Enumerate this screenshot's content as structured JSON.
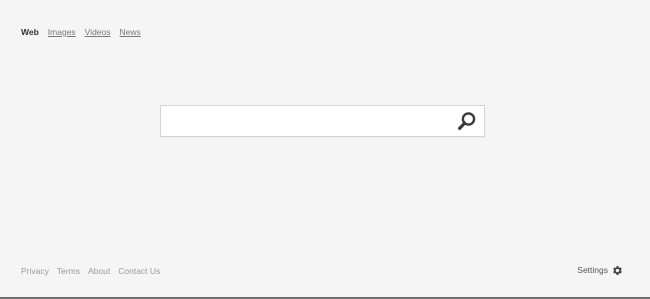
{
  "nav": {
    "items": [
      {
        "label": "Web",
        "active": true
      },
      {
        "label": "Images",
        "active": false
      },
      {
        "label": "Videos",
        "active": false
      },
      {
        "label": "News",
        "active": false
      }
    ]
  },
  "search": {
    "value": "",
    "placeholder": "",
    "button_icon": "search-icon"
  },
  "footer": {
    "links": [
      "Privacy",
      "Terms",
      "About",
      "Contact Us"
    ],
    "settings_label": "Settings",
    "settings_icon": "gear-icon"
  },
  "colors": {
    "background": "#f5f5f5",
    "active_text": "#333333",
    "link_text": "#777777",
    "footer_text": "#9a9a9a"
  }
}
